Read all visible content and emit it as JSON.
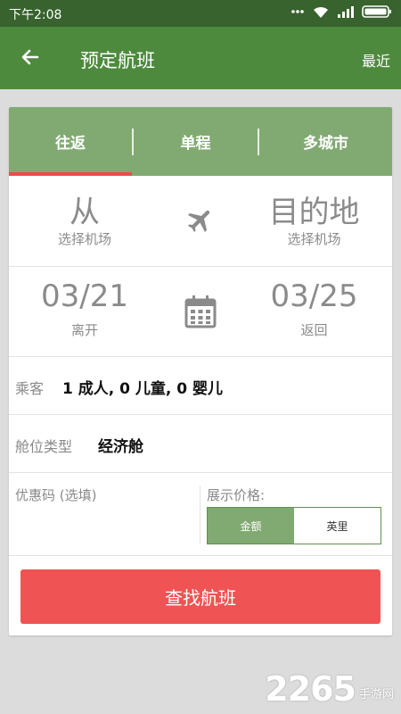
{
  "status_bar": {
    "time": "下午2:08",
    "icons": [
      "dots-icon",
      "wifi-icon",
      "signal-icon",
      "battery-icon"
    ]
  },
  "app_bar": {
    "title": "预定航班",
    "recent": "最近",
    "back_icon": "arrow-left-icon"
  },
  "tabs": [
    {
      "label": "往返",
      "active": true
    },
    {
      "label": "单程",
      "active": false
    },
    {
      "label": "多城市",
      "active": false
    }
  ],
  "route": {
    "from": {
      "title": "从",
      "sub": "选择机场"
    },
    "to": {
      "title": "目的地",
      "sub": "选择机场"
    },
    "icon": "airplane-icon"
  },
  "dates": {
    "depart": {
      "date": "03/21",
      "label": "离开"
    },
    "return": {
      "date": "03/25",
      "label": "返回"
    },
    "icon": "calendar-icon"
  },
  "passengers": {
    "label": "乘客",
    "value": "1 成人, 0 儿童, 0 婴儿"
  },
  "cabin": {
    "label": "舱位类型",
    "value": "经济舱"
  },
  "promo": {
    "placeholder": "优惠码 (选填)"
  },
  "price_display": {
    "label": "展示价格:",
    "options": [
      {
        "label": "金额",
        "selected": true
      },
      {
        "label": "英里",
        "selected": false
      }
    ]
  },
  "search_button": "查找航班",
  "watermark": {
    "number": "2265",
    "suffix": "手游网"
  },
  "colors": {
    "status_bar": "#38622e",
    "app_bar": "#4e8a3e",
    "tabs": "#81aa72",
    "accent_red": "#f05353",
    "tab_indicator": "#ee4a4a"
  }
}
